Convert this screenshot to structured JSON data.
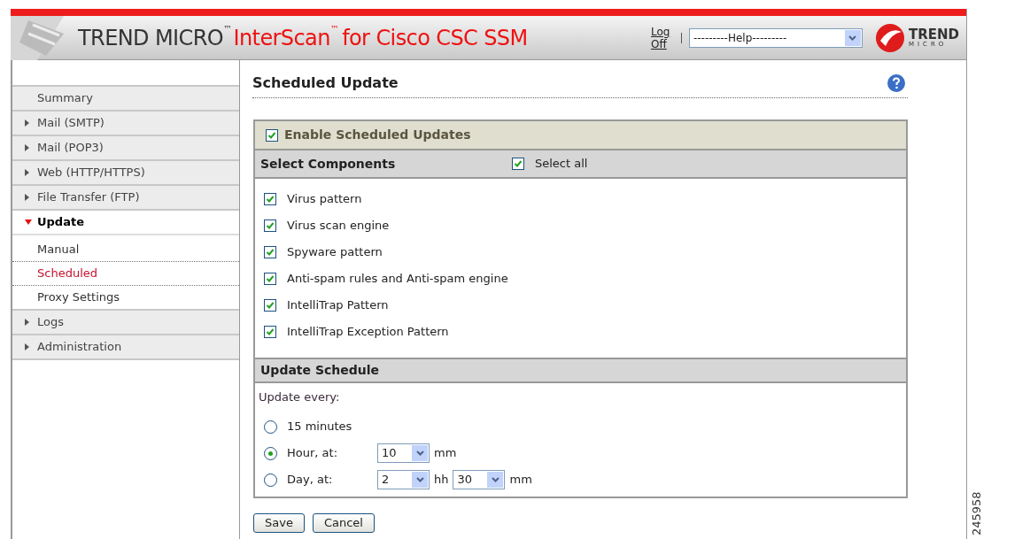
{
  "header": {
    "brand": "TREND MICRO",
    "brand_tm": "™",
    "product": "InterScan",
    "product_tm": "™",
    "product_suffix": "for Cisco CSC SSM",
    "logoff": "Log Off",
    "help_select": "---------Help---------",
    "logo_top": "TREND",
    "logo_bottom": "MICRO"
  },
  "sidebar": {
    "items": [
      {
        "label": "Summary",
        "kind": "plain"
      },
      {
        "label": "Mail (SMTP)",
        "kind": "group",
        "expanded": false
      },
      {
        "label": "Mail (POP3)",
        "kind": "group",
        "expanded": false
      },
      {
        "label": "Web (HTTP/HTTPS)",
        "kind": "group",
        "expanded": false
      },
      {
        "label": "File Transfer (FTP)",
        "kind": "group",
        "expanded": false
      },
      {
        "label": "Update",
        "kind": "group",
        "expanded": true,
        "children": [
          {
            "label": "Manual",
            "selected": false
          },
          {
            "label": "Scheduled",
            "selected": true
          },
          {
            "label": "Proxy Settings",
            "selected": false
          }
        ]
      },
      {
        "label": "Logs",
        "kind": "group",
        "expanded": false
      },
      {
        "label": "Administration",
        "kind": "group",
        "expanded": false
      }
    ]
  },
  "page": {
    "title": "Scheduled Update",
    "enable": {
      "label": "Enable Scheduled Updates",
      "checked": true
    },
    "components": {
      "heading": "Select Components",
      "select_all": {
        "label": "Select all",
        "checked": true
      },
      "items": [
        {
          "label": "Virus pattern",
          "checked": true
        },
        {
          "label": "Virus scan engine",
          "checked": true
        },
        {
          "label": "Spyware pattern",
          "checked": true
        },
        {
          "label": "Anti-spam rules and Anti-spam engine",
          "checked": true
        },
        {
          "label": "IntelliTrap Pattern",
          "checked": true
        },
        {
          "label": "IntelliTrap Exception Pattern",
          "checked": true
        }
      ]
    },
    "schedule": {
      "heading": "Update Schedule",
      "prompt": "Update every:",
      "options": [
        {
          "label": "15 minutes",
          "selected": false
        },
        {
          "label": "Hour, at:",
          "selected": true,
          "fields": [
            {
              "value": "10",
              "unit": "mm"
            }
          ]
        },
        {
          "label": "Day, at:",
          "selected": false,
          "fields": [
            {
              "value": "2",
              "unit": "hh"
            },
            {
              "value": "30",
              "unit": "mm"
            }
          ]
        }
      ]
    },
    "buttons": [
      "Save",
      "Cancel"
    ]
  },
  "figure_number": "245958"
}
